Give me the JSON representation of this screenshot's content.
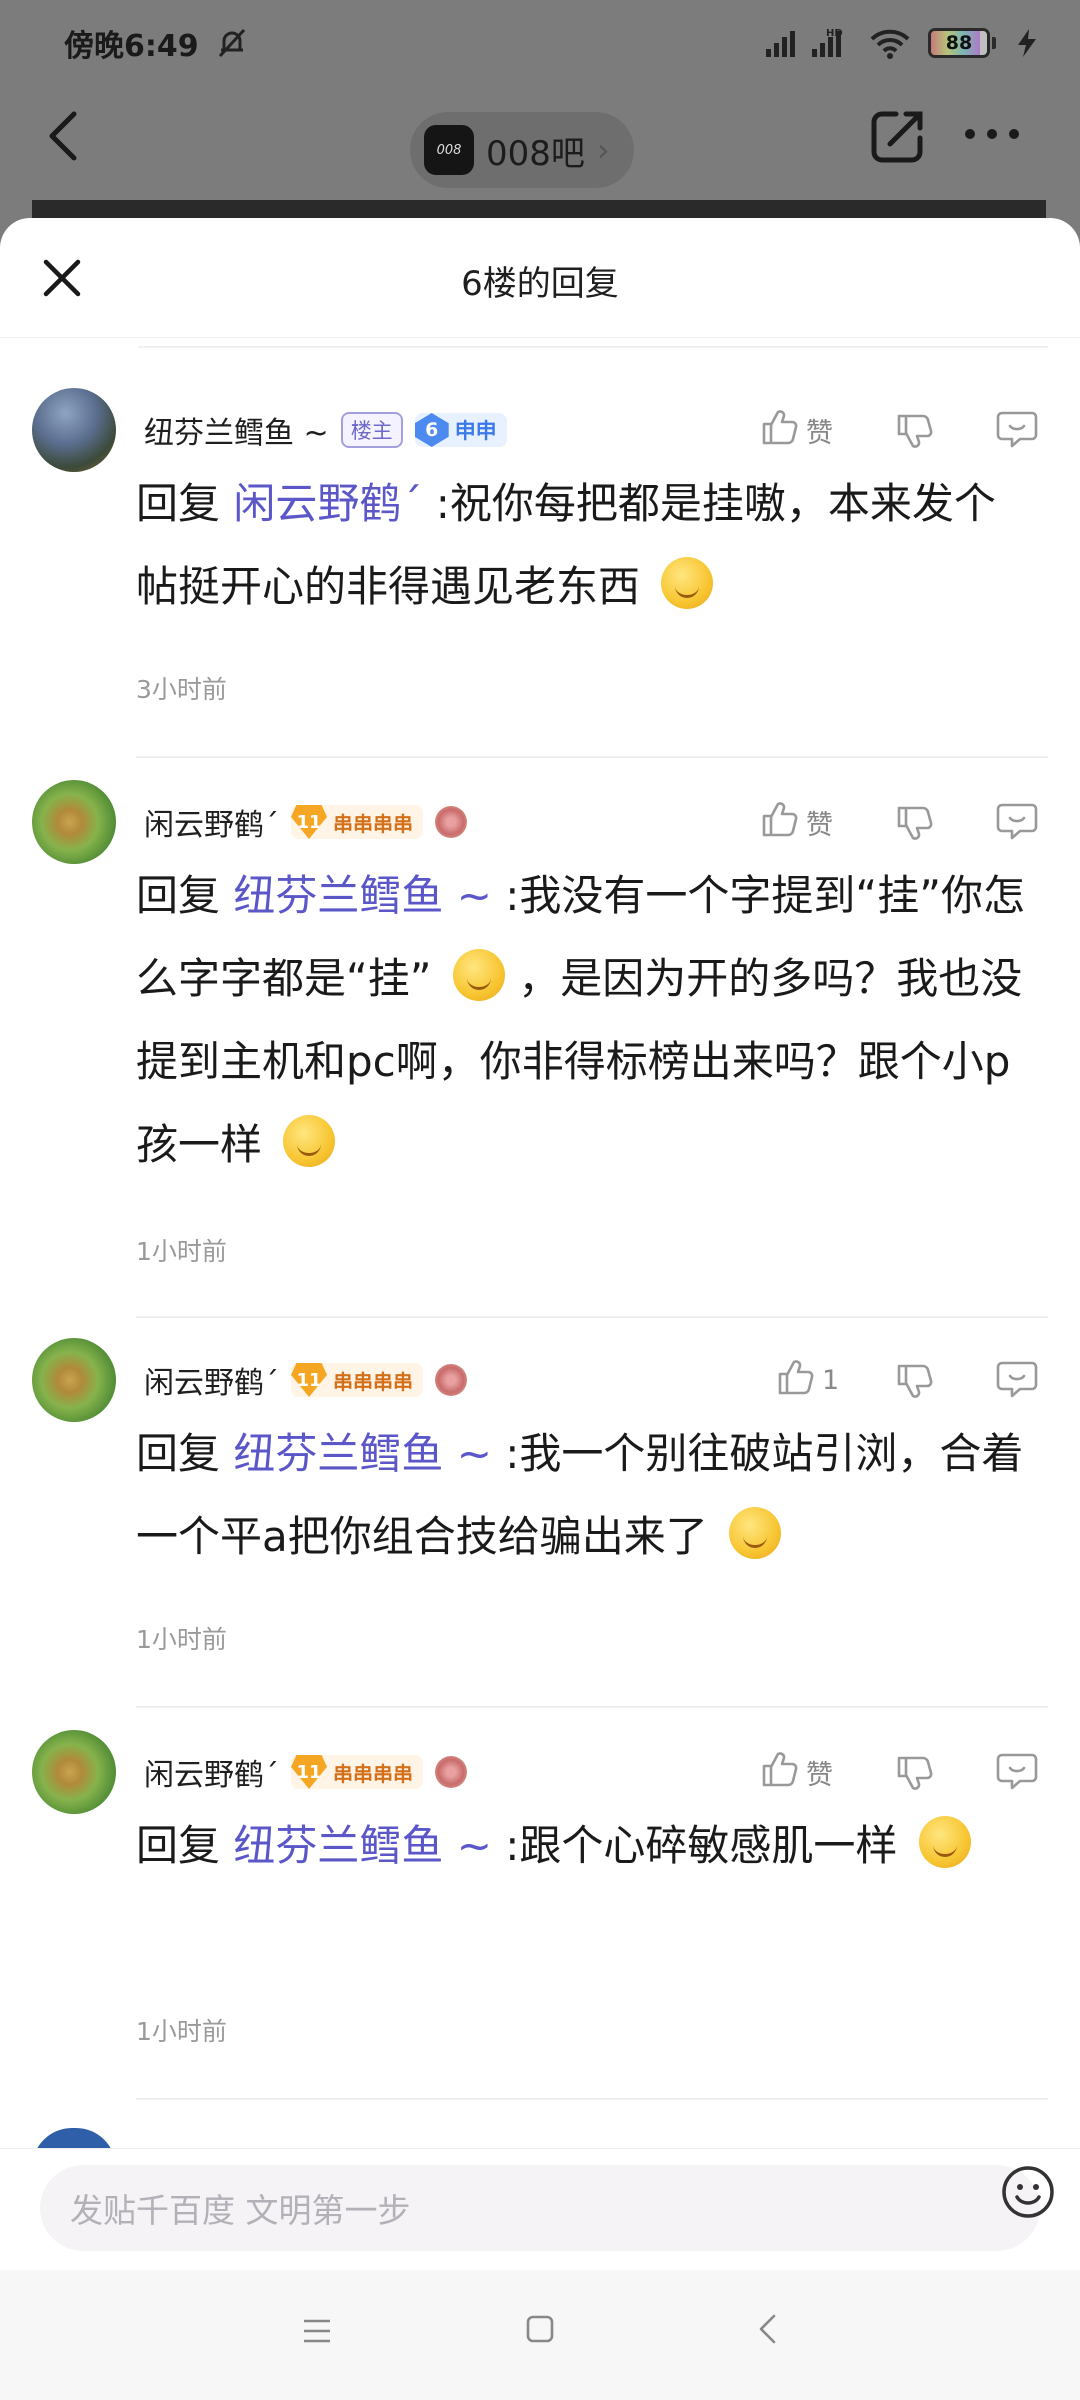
{
  "status_bar": {
    "time": "傍晚6:49",
    "battery": "88",
    "battery_level": 0.88
  },
  "nav": {
    "forum_name": "008吧",
    "forum_logo_text": "008"
  },
  "sheet": {
    "title": "6楼的回复"
  },
  "replies": [
    {
      "username": "纽芬兰鳕鱼 ~",
      "badges": {
        "lz": "楼主",
        "level": "6",
        "level_text": "申申"
      },
      "likes": "赞",
      "reply_prefix": "回复",
      "reply_to": "闲云野鹤ˊ",
      "text": " :祝你每把都是挂嗷，本来发个帖挺开心的非得遇见老东西",
      "time": "3小时前"
    },
    {
      "username": "闲云野鹤ˊ",
      "badges": {
        "level": "11",
        "level_text": "串串串串"
      },
      "likes": "赞",
      "reply_prefix": "回复",
      "reply_to": "纽芬兰鳕鱼 ~",
      "text_part1": " :我没有一个字提到“挂”你怎么字字都是“挂”",
      "text_part2": "，是因为开的多吗？我也没提到主机和pc啊，你非得标榜出来吗？跟个小p孩一样",
      "time": "1小时前"
    },
    {
      "username": "闲云野鹤ˊ",
      "badges": {
        "level": "11",
        "level_text": "串串串串"
      },
      "likes": "1",
      "reply_prefix": "回复",
      "reply_to": "纽芬兰鳕鱼 ~",
      "text": " :我一个别往破站引浏，合着一个平a把你组合技给骗出来了",
      "time": "1小时前"
    },
    {
      "username": "闲云野鹤ˊ",
      "badges": {
        "level": "11",
        "level_text": "串串串串"
      },
      "likes": "赞",
      "reply_prefix": "回复",
      "reply_to": "纽芬兰鳕鱼 ~",
      "text": " :跟个心碎敏感肌一样",
      "time": "1小时前"
    }
  ],
  "input": {
    "placeholder": "发贴千百度 文明第一步"
  },
  "icons": [
    "bell-off-icon",
    "signal-icon",
    "wifi-icon",
    "charge-icon",
    "back-icon",
    "share-icon",
    "more-icon",
    "close-icon",
    "thumb-up-icon",
    "thumb-down-icon",
    "reply-icon",
    "emoji-icon",
    "menu-icon",
    "home-icon",
    "nav-back-icon"
  ],
  "colors": {
    "accent": "#5b57c9",
    "muted": "#9a9a9a",
    "badge_blue": "#4c8af0",
    "badge_gold": "#f5a623"
  }
}
